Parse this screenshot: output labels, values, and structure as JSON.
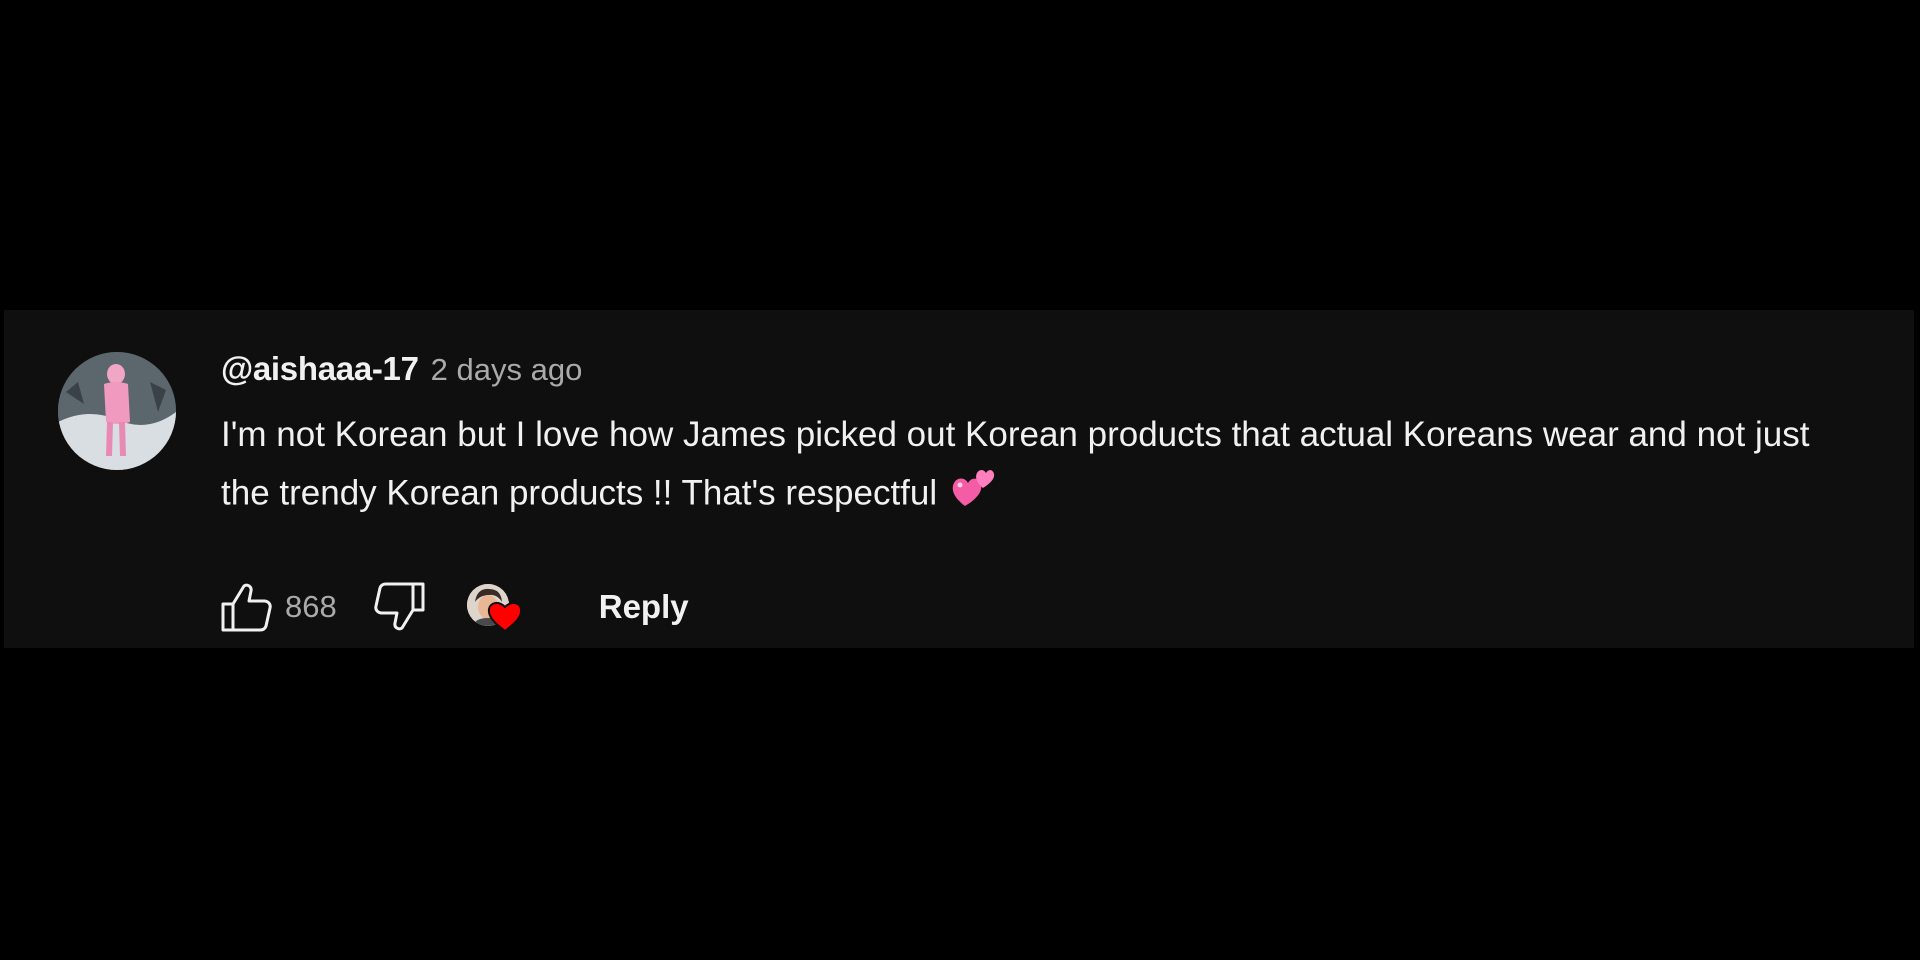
{
  "comment": {
    "author": "@aishaaa-17",
    "timestamp": "2 days ago",
    "text": "I'm not Korean but I love how James picked out Korean products that actual Koreans wear and not just the trendy Korean products !! That's respectful",
    "emoji": "two-hearts-emoji"
  },
  "actions": {
    "like_icon": "thumbs-up-icon",
    "like_count": "868",
    "dislike_icon": "thumbs-down-icon",
    "creator_heart_icon": "creator-heart-icon",
    "reply_label": "Reply"
  },
  "colors": {
    "page_background": "#000000",
    "card_background": "#0f0f0f",
    "primary_text": "#f1f1f1",
    "secondary_text": "#aaaaaa",
    "heart_red": "#ff0000",
    "emoji_pink": "#f45ca6"
  }
}
